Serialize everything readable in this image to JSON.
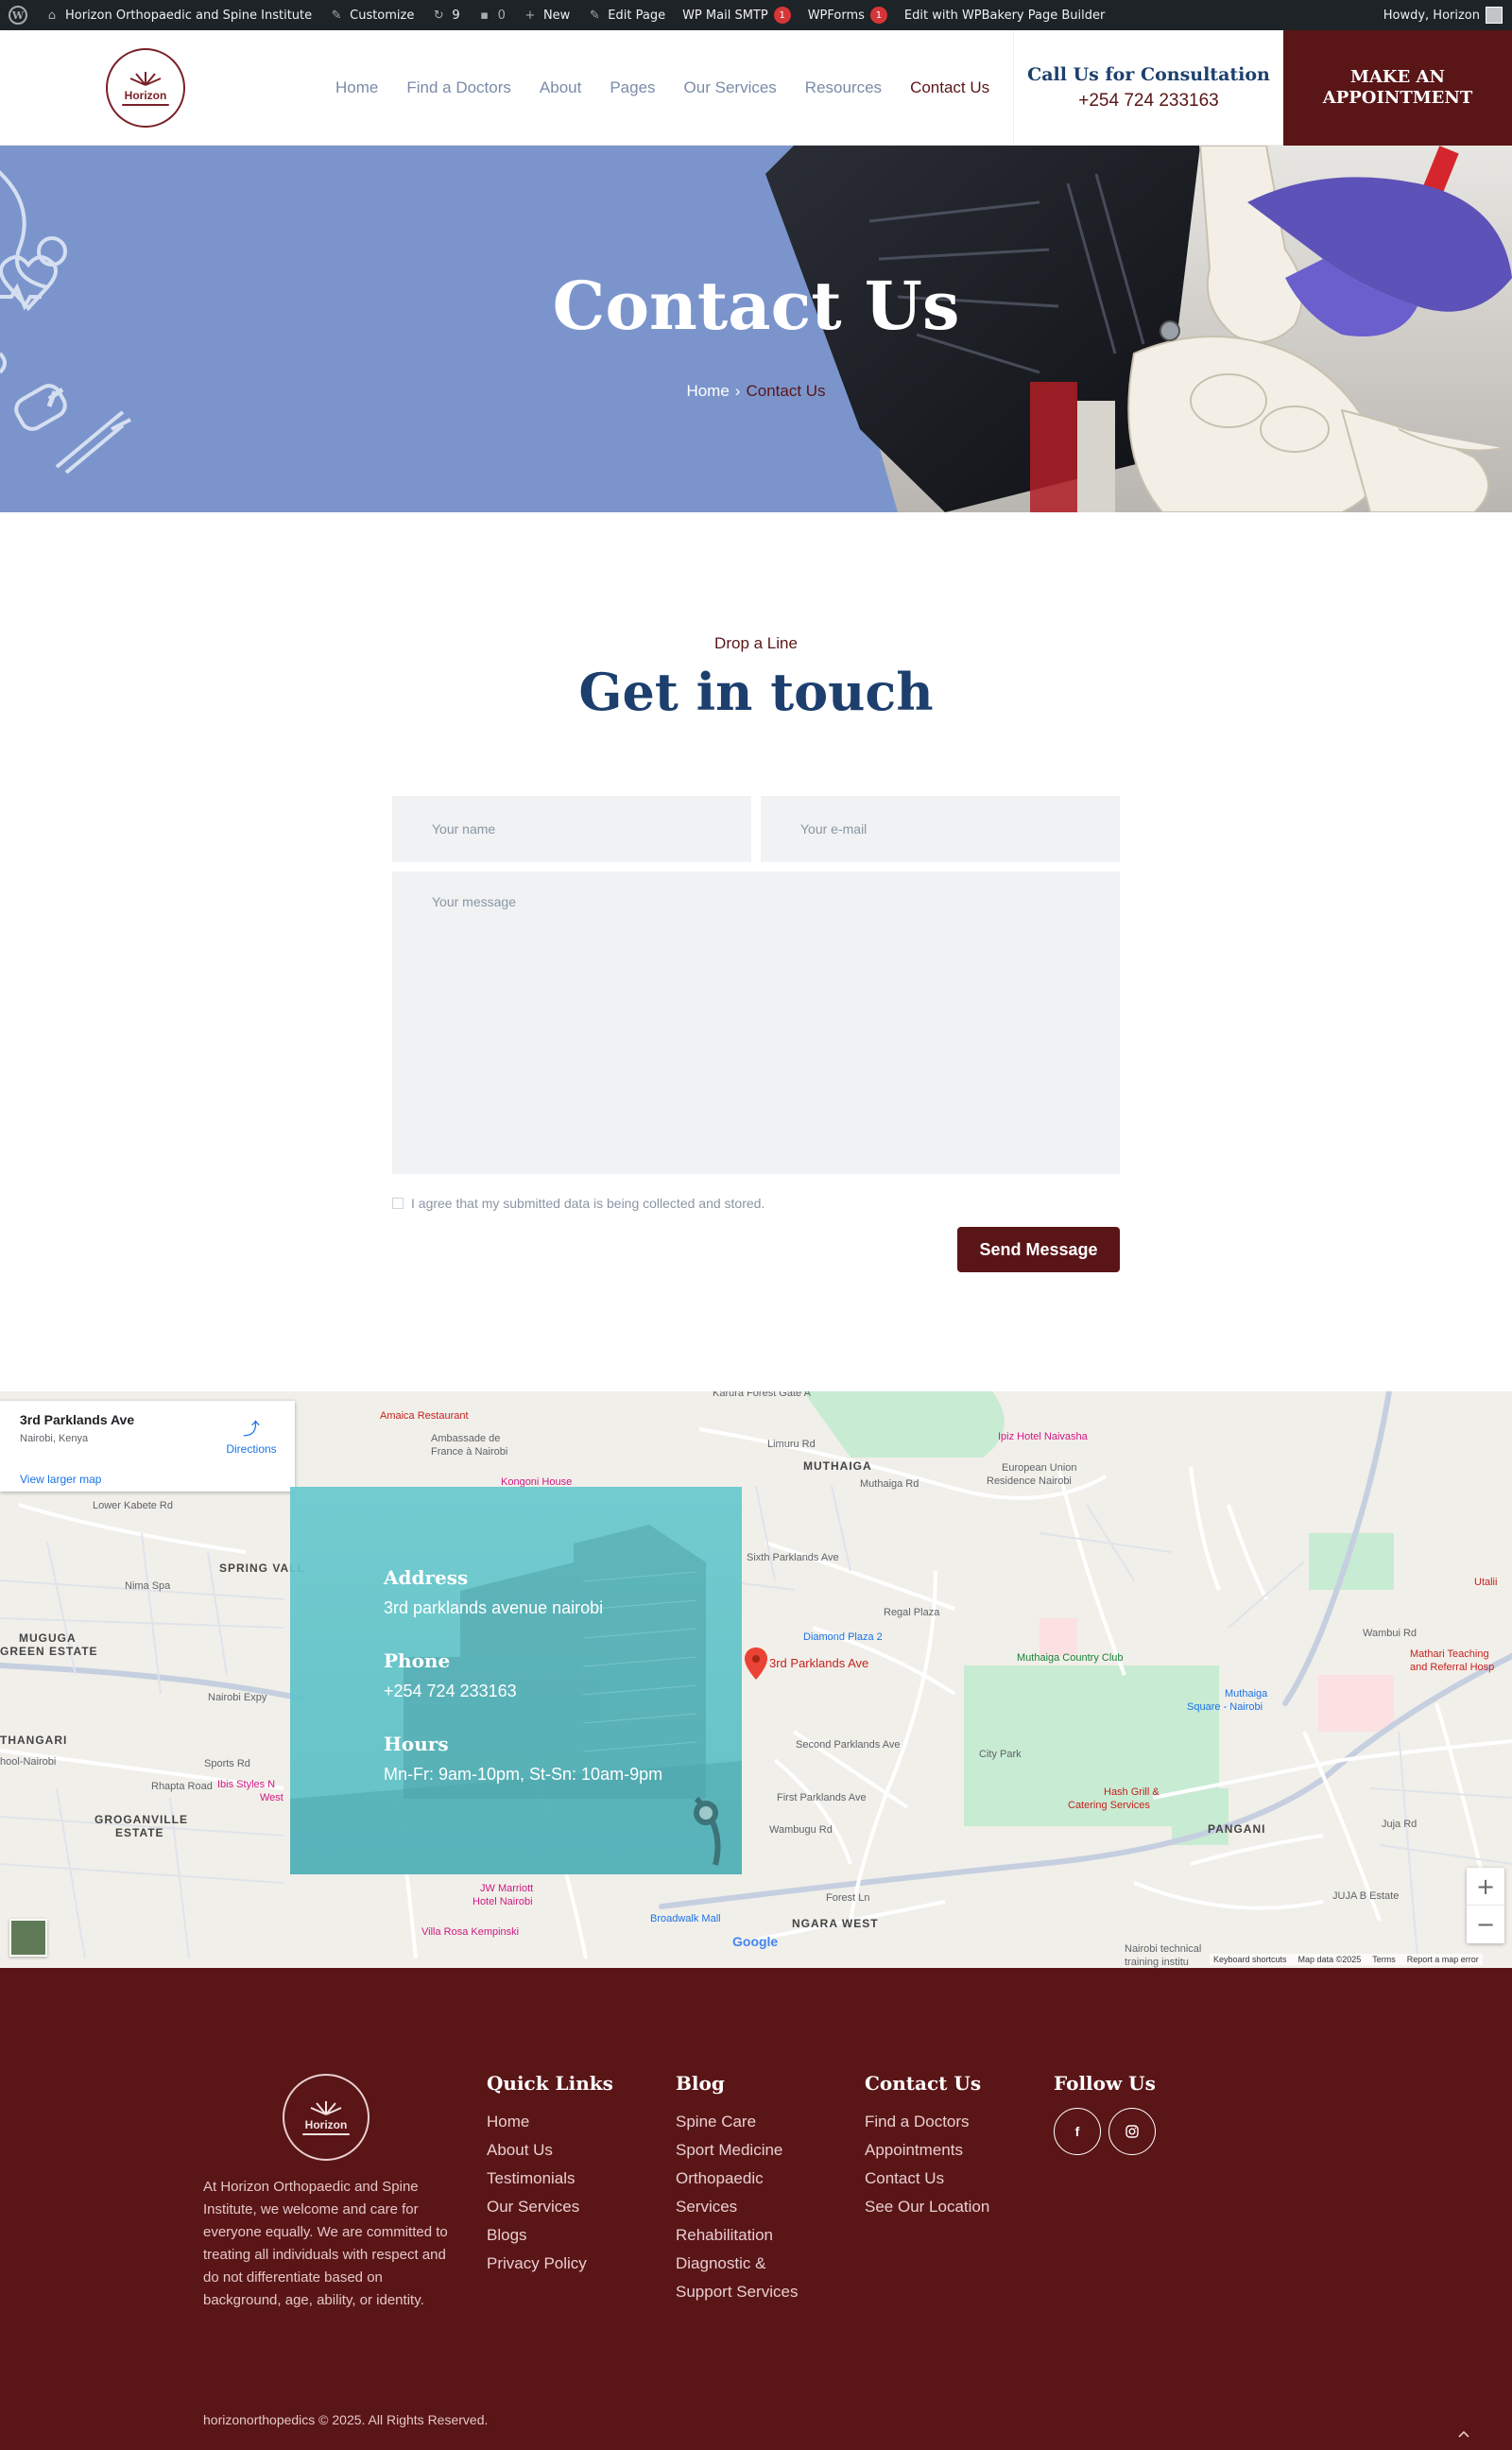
{
  "adminbar": {
    "site_name": "Horizon Orthopaedic and Spine Institute",
    "customize": "Customize",
    "updates_count": "9",
    "comments_count": "0",
    "new": "New",
    "edit_page": "Edit Page",
    "smtp": "WP Mail SMTP",
    "smtp_badge": "1",
    "wpforms": "WPForms",
    "wpforms_badge": "1",
    "wpbakery": "Edit with WPBakery Page Builder",
    "howdy": "Howdy, Horizon"
  },
  "header": {
    "logo_text": "Horizon",
    "nav": [
      "Home",
      "Find a Doctors",
      "About",
      "Pages",
      "Our Services",
      "Resources",
      "Contact Us"
    ],
    "active_nav": "Contact Us",
    "call_title": "Call Us for Consultation",
    "call_phone": "+254 724 233163",
    "appointment_line1": "MAKE AN",
    "appointment_line2": "APPOINTMENT"
  },
  "hero": {
    "title": "Contact Us",
    "breadcrumb_home": "Home",
    "breadcrumb_sep": "›",
    "breadcrumb_current": "Contact Us"
  },
  "contact": {
    "eyebrow": "Drop a Line",
    "heading": "Get in touch",
    "name_placeholder": "Your name",
    "email_placeholder": "Your e-mail",
    "message_placeholder": "Your message",
    "consent": "I agree that my submitted data is being collected and stored.",
    "send": "Send Message"
  },
  "map": {
    "card_title": "3rd Parklands Ave",
    "card_sub": "Nairobi, Kenya",
    "card_link": "View larger map",
    "directions": "Directions",
    "pin_label": "3rd Parklands Ave",
    "labels": {
      "amaica": "Amaica Restaurant",
      "ambassade1": "Ambassade de",
      "ambassade2": "France à Nairobi",
      "kengeni": "Kongoni House",
      "karura": "Karura Forest Gate A",
      "limuru": "Limuru Rd",
      "muthaiga": "MUTHAIGA",
      "muthaiga_rd": "Muthaiga Rd",
      "ipiz": "Ipiz Hotel Naivasha",
      "eu1": "European Union",
      "eu2": "Residence Nairobi",
      "lower_kabete": "Lower Kabete Rd",
      "spring_valley": "SPRING VALL",
      "nima": "Nima Spa",
      "muguga": "MUGUGA",
      "green_estate": "GREEN ESTATE",
      "nairobi_expy": "Nairobi Expy",
      "thangari": "THANGARI",
      "school": "hool-Nairobi",
      "sports": "Sports Rd",
      "rhapta": "Rhapta Road",
      "ibis1": "Ibis Styles N",
      "ibis2": "West",
      "groganville1": "GROGANVILLE",
      "groganville2": "ESTATE",
      "sixth": "Sixth Parklands Ave",
      "diamond": "Diamond Plaza 2",
      "regal": "Regal Plaza",
      "muthaiga_club": "Muthaiga Country Club",
      "utalii": "Utalii",
      "wambui": "Wambui Rd",
      "mathari1": "Mathari Teaching",
      "mathari2": "and Referral Hosp",
      "muthaiga_sq1": "Muthaiga",
      "muthaiga_sq2": "Square - Nairobi",
      "city_park": "City Park",
      "second": "Second Parklands Ave",
      "first": "First Parklands Ave",
      "hash1": "Hash Grill &",
      "hash2": "Catering Services",
      "pangani": "PANGANI",
      "juja": "Juja Rd",
      "jw1": "JW Marriott",
      "jw2": "Hotel Nairobi",
      "villa": "Villa Rosa Kempinski",
      "broadwalk": "Broadwalk Mall",
      "ngara": "NGARA WEST",
      "forest": "Forest Ln",
      "juja_estate": "JUJA B Estate",
      "technical1": "Nairobi technical",
      "technical2": "training institu",
      "limuru2": "Limuru Rd",
      "wambugu": "Wambugu Rd"
    },
    "google": "Google",
    "footer_links": [
      "Keyboard shortcuts",
      "Map data ©2025",
      "Terms",
      "Report a map error"
    ],
    "zoom_in": "+",
    "zoom_out": "−"
  },
  "info": {
    "address_label": "Address",
    "address": "3rd parklands avenue nairobi",
    "phone_label": "Phone",
    "phone": "+254 724 233163",
    "hours_label": "Hours",
    "hours": "Mn-Fr: 9am-10pm, St-Sn: 10am-9pm"
  },
  "footer": {
    "logo_text": "Horizon",
    "about": "At Horizon Orthopaedic and Spine Institute, we welcome and care for everyone equally. We are committed to treating all individuals with respect and do not differentiate based on background, age, ability, or identity.",
    "quick_links_title": "Quick Links",
    "quick_links": [
      "Home",
      "About Us",
      "Testimonials",
      "Our Services",
      "Blogs",
      "Privacy Policy"
    ],
    "blog_title": "Blog",
    "blog_links": [
      "Spine Care",
      "Sport Medicine",
      "Orthopaedic Services",
      "Rehabilitation",
      "Diagnostic & Support Services"
    ],
    "contact_title": "Contact Us",
    "contact_links": [
      "Find a Doctors",
      "Appointments",
      "Contact Us",
      "See Our Location"
    ],
    "follow_title": "Follow Us",
    "social": [
      "f",
      "ig"
    ],
    "copyright": "horizonorthopedics © 2025. All Rights Reserved.",
    "to_top": "^"
  },
  "colors": {
    "brand_maroon": "#5a1517",
    "brand_navy": "#1c3f6e",
    "hero_blue": "#7b95cc",
    "info_teal": "#62c4c9"
  }
}
